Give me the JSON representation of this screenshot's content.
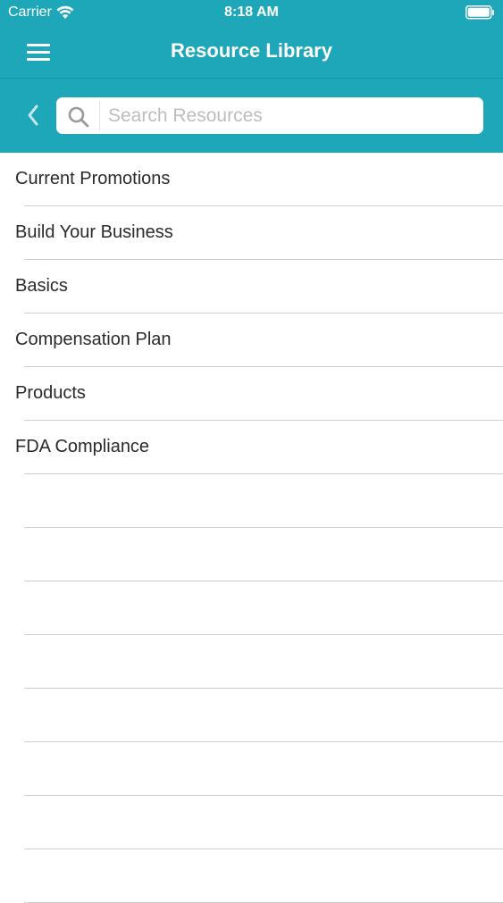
{
  "status_bar": {
    "carrier": "Carrier",
    "time": "8:18 AM",
    "icons": [
      "wifi-icon",
      "battery-icon"
    ]
  },
  "nav": {
    "title": "Resource Library",
    "menu_icon": "hamburger-menu-icon"
  },
  "search": {
    "placeholder": "Search Resources",
    "value": "",
    "back_icon": "chevron-left-icon",
    "icon": "search-icon"
  },
  "list": {
    "items": [
      {
        "label": "Current Promotions"
      },
      {
        "label": "Build Your Business"
      },
      {
        "label": "Basics"
      },
      {
        "label": "Compensation Plan"
      },
      {
        "label": "Products"
      },
      {
        "label": "FDA Compliance"
      }
    ]
  },
  "colors": {
    "header_bg": "#1ea7b8",
    "text": "#2a2a2a",
    "separator": "#cfcfcf"
  }
}
